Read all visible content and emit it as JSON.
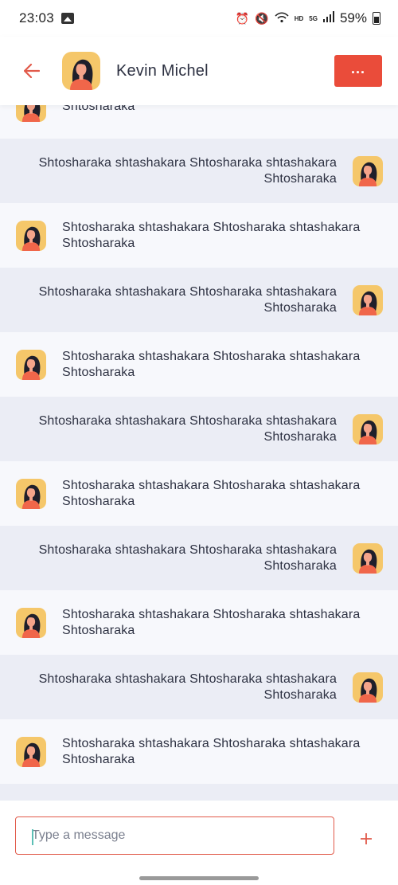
{
  "status_bar": {
    "time": "23:03",
    "battery": "59%",
    "network_small": "HD",
    "network_gen": "5G"
  },
  "header": {
    "contact_name": "Kevin Michel"
  },
  "colors": {
    "accent": "#ea4c3a",
    "incoming_bg": "#f7f8fc",
    "outgoing_bg": "#ebedf5"
  },
  "messages": [
    {
      "direction": "in",
      "text": "Shtosharaka"
    },
    {
      "direction": "out",
      "text": "Shtosharaka shtashakara Shtosharaka shtashakara Shtosharaka"
    },
    {
      "direction": "in",
      "text": "Shtosharaka shtashakara Shtosharaka shtashakara Shtosharaka"
    },
    {
      "direction": "out",
      "text": "Shtosharaka shtashakara Shtosharaka shtashakara Shtosharaka"
    },
    {
      "direction": "in",
      "text": "Shtosharaka shtashakara Shtosharaka shtashakara Shtosharaka"
    },
    {
      "direction": "out",
      "text": "Shtosharaka shtashakara Shtosharaka shtashakara Shtosharaka"
    },
    {
      "direction": "in",
      "text": "Shtosharaka shtashakara Shtosharaka shtashakara Shtosharaka"
    },
    {
      "direction": "out",
      "text": "Shtosharaka shtashakara Shtosharaka shtashakara Shtosharaka"
    },
    {
      "direction": "in",
      "text": "Shtosharaka shtashakara Shtosharaka shtashakara Shtosharaka"
    },
    {
      "direction": "out",
      "text": "Shtosharaka shtashakara Shtosharaka shtashakara Shtosharaka"
    },
    {
      "direction": "in",
      "text": "Shtosharaka shtashakara Shtosharaka shtashakara Shtosharaka"
    },
    {
      "direction": "out",
      "text": ""
    }
  ],
  "composer": {
    "placeholder": "Type a message",
    "value": ""
  }
}
